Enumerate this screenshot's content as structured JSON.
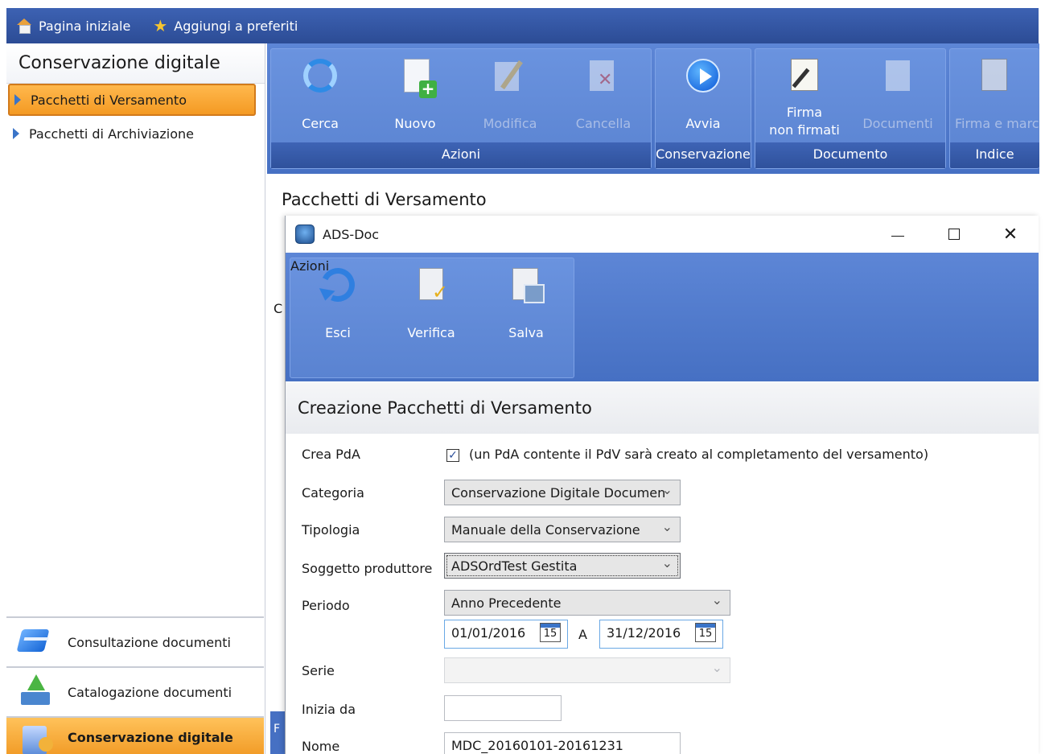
{
  "topbar": {
    "home_label": "Pagina iniziale",
    "favorites_label": "Aggiungi a preferiti"
  },
  "sidebar": {
    "title": "Conservazione digitale",
    "items": [
      {
        "label": "Pacchetti di Versamento",
        "selected": true
      },
      {
        "label": "Pacchetti di Archiviazione",
        "selected": false
      }
    ],
    "bottom_nav": [
      {
        "label": "Consultazione documenti",
        "icon": "folder-icon"
      },
      {
        "label": "Catalogazione documenti",
        "icon": "upload-icon"
      },
      {
        "label": "Conservazione digitale",
        "icon": "archive-icon",
        "selected": true
      }
    ]
  },
  "ribbon": {
    "groups": [
      {
        "label": "Azioni",
        "buttons": [
          "Cerca",
          "Nuovo",
          "Modifica",
          "Cancella"
        ]
      },
      {
        "label": "Conservazione",
        "buttons": [
          "Avvia"
        ]
      },
      {
        "label": "Documento",
        "buttons": [
          "Firma\nnon firmati",
          "Documenti"
        ]
      },
      {
        "label": "Indice",
        "buttons": [
          "Firma e marca"
        ]
      }
    ],
    "buttons": {
      "cerca": "Cerca",
      "nuovo": "Nuovo",
      "modifica": "Modifica",
      "cancella": "Cancella",
      "avvia": "Avvia",
      "firma_line1": "Firma",
      "firma_line2": "non firmati",
      "documenti": "Documenti",
      "firma_marca": "Firma e marca"
    },
    "group_labels": {
      "azioni": "Azioni",
      "conservazione": "Conservazione",
      "documento": "Documento",
      "indice": "Indice"
    }
  },
  "main": {
    "page_heading": "Pacchetti di Versamento",
    "stub_a": "C",
    "stub_b": "F"
  },
  "dialog": {
    "title": "ADS-Doc",
    "controls": {
      "close": "✕"
    },
    "ribbon": {
      "group_label": "Azioni",
      "esci": "Esci",
      "verifica": "Verifica",
      "salva": "Salva"
    },
    "section_title": "Creazione Pacchetti di Versamento",
    "form": {
      "crea_pda_label": "Crea PdA",
      "crea_pda_checked": true,
      "crea_pda_check": "✓",
      "crea_pda_note": "(un PdA contente il PdV sarà creato al completamento del versamento)",
      "categoria_label": "Categoria",
      "categoria_value": "Conservazione Digitale Documen",
      "tipologia_label": "Tipologia",
      "tipologia_value": "Manuale della Conservazione",
      "soggetto_label": "Soggetto produttore",
      "soggetto_value": "ADSOrdTest Gestita",
      "periodo_label": "Periodo",
      "periodo_value": "Anno Precedente",
      "date_from": "01/01/2016",
      "date_sep": "A",
      "date_to": "31/12/2016",
      "calendar_day": "15",
      "serie_label": "Serie",
      "serie_value": "",
      "inizia_label": "Inizia da",
      "inizia_value": "",
      "nome_label": "Nome",
      "nome_value": "MDC_20160101-20161231"
    }
  }
}
